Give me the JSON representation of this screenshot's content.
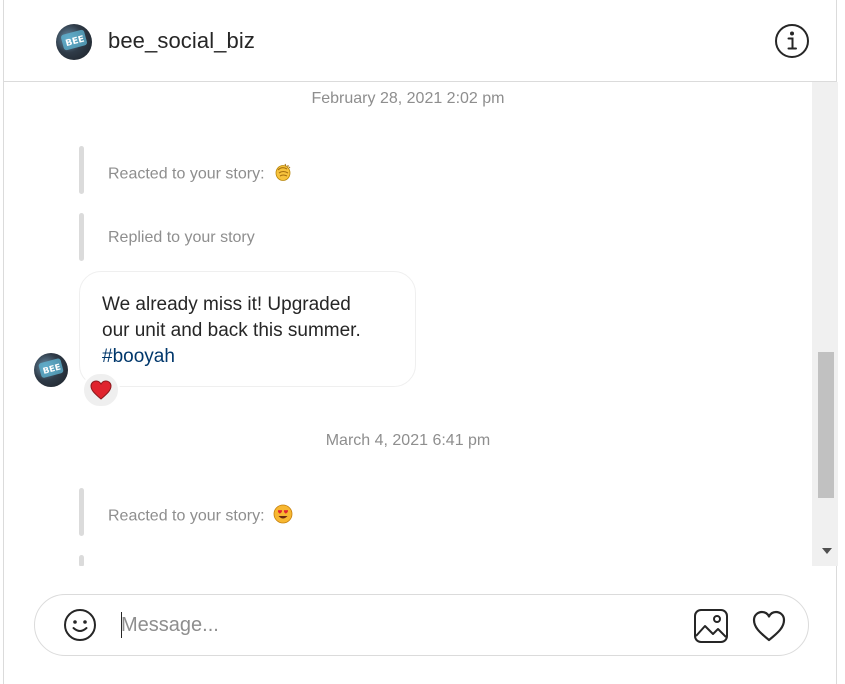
{
  "header": {
    "username": "bee_social_biz",
    "avatar_icon": "profile-avatar",
    "info_icon": "info-icon"
  },
  "thread": {
    "timestamp_1": "February 28, 2021 2:02 pm",
    "story_reaction_1": {
      "text": "Reacted to your story:",
      "emoji": "clapping-hands-emoji"
    },
    "story_reply": {
      "text": "Replied to your story"
    },
    "message": {
      "line_1": "We already miss it! Upgraded",
      "line_2": "our unit and back this summer.",
      "hashtag": "#booyah",
      "reaction": "red-heart"
    },
    "timestamp_2": "March 4, 2021 6:41 pm",
    "story_reaction_2": {
      "text": "Reacted to your story:",
      "emoji": "heart-eyes-emoji"
    }
  },
  "composer": {
    "placeholder": "Message...",
    "value": "",
    "icons": [
      "smiley-icon",
      "image-icon",
      "heart-icon"
    ]
  },
  "colors": {
    "text": "#262626",
    "secondary_text": "#8e8e8e",
    "hashtag": "#00376b",
    "border": "#dbdbdb",
    "heart_red": "#ed4956"
  }
}
